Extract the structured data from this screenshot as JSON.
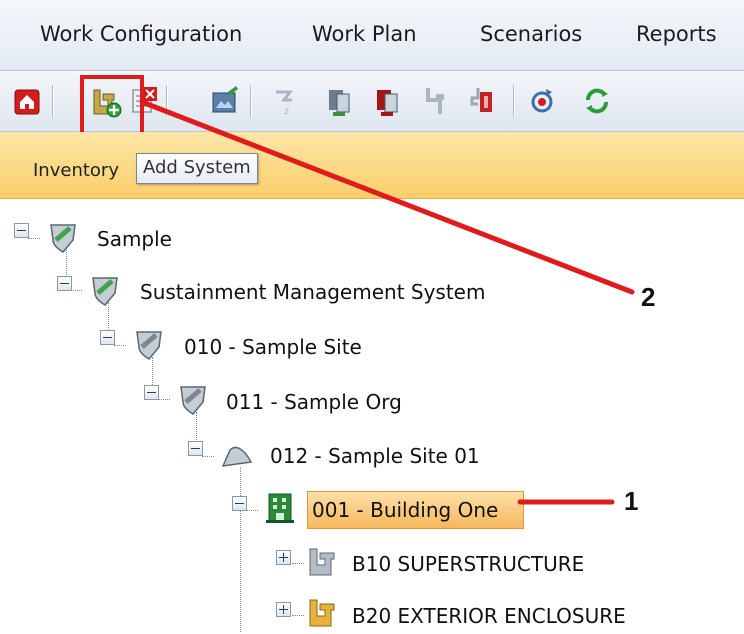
{
  "menu": {
    "work_configuration": "Work Configuration",
    "work_plan": "Work Plan",
    "scenarios": "Scenarios",
    "reports": "Reports"
  },
  "orange_bar": {
    "text": "Inventory"
  },
  "tooltip": {
    "text": "Add System"
  },
  "tree": {
    "sample": "Sample",
    "sms": "Sustainment Management System",
    "site": "010 - Sample Site",
    "org": "011 - Sample Org",
    "site01": "012 - Sample Site 01",
    "building": "001 - Building One",
    "b10": "B10 SUPERSTRUCTURE",
    "b20": "B20 EXTERIOR ENCLOSURE"
  },
  "annotations": {
    "one": "1",
    "two": "2"
  },
  "colors": {
    "annotation_red": "#e01b1b",
    "selected_bg": "#f7b75c",
    "toolbar_bg": "#e3eaf3",
    "orange_bar": "#f9cf6a"
  },
  "icons": [
    "home-icon",
    "add-system-icon",
    "delete-system-icon",
    "edit-icon",
    "sort-icon",
    "copy-icon",
    "paste-icon",
    "split-icon",
    "move-icon",
    "refresh-icon",
    "sync-icon"
  ]
}
